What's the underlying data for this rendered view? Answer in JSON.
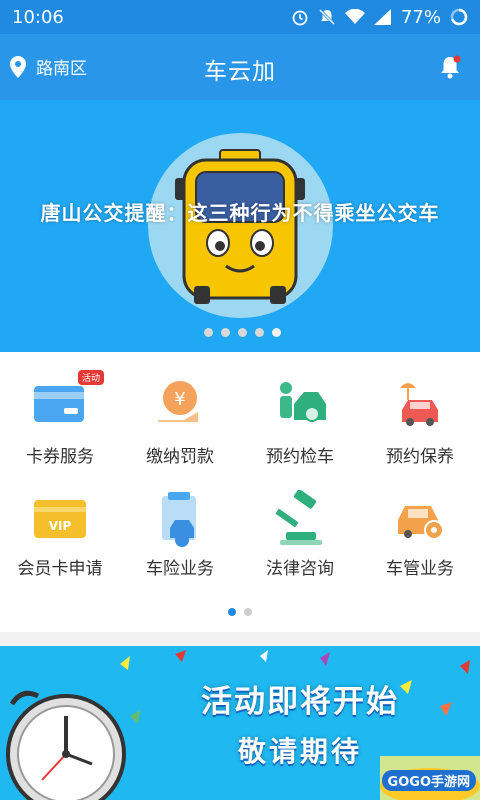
{
  "status": {
    "time": "10:06",
    "battery": "77%"
  },
  "header": {
    "location": "路南区",
    "title": "车云加"
  },
  "banner": {
    "text": "唐山公交提醒：这三种行为不得乘坐公交车"
  },
  "grid": {
    "items": [
      {
        "label": "卡券服务",
        "icon": "card-coupon-icon",
        "badge": "活动"
      },
      {
        "label": "缴纳罚款",
        "icon": "fine-payment-icon"
      },
      {
        "label": "预约检车",
        "icon": "car-inspection-icon"
      },
      {
        "label": "预约保养",
        "icon": "car-maintenance-icon"
      },
      {
        "label": "会员卡申请",
        "icon": "vip-card-icon"
      },
      {
        "label": "车险业务",
        "icon": "car-insurance-icon"
      },
      {
        "label": "法律咨询",
        "icon": "legal-gavel-icon"
      },
      {
        "label": "车管业务",
        "icon": "vehicle-admin-icon"
      }
    ]
  },
  "promo": {
    "line1": "活动即将开始",
    "line2": "敬请期待",
    "watermark": "GOGO手游网"
  },
  "colors": {
    "primary": "#2a96ea",
    "banner": "#21a8f4",
    "accent_red": "#e53935"
  }
}
